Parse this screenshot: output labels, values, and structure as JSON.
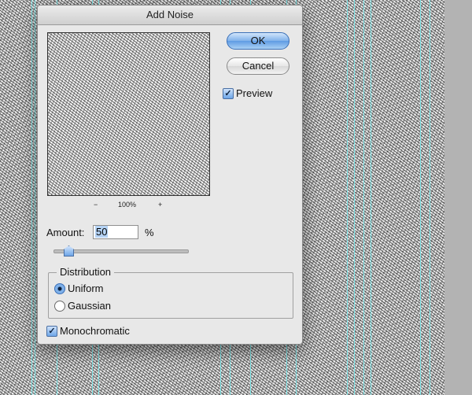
{
  "dialog": {
    "title": "Add Noise",
    "ok_label": "OK",
    "cancel_label": "Cancel",
    "preview_label": "Preview",
    "preview_checked": true,
    "zoom_out_symbol": "−",
    "zoom_level": "100%",
    "zoom_in_symbol": "+",
    "amount_label": "Amount:",
    "amount_value": "50",
    "amount_unit": "%",
    "amount_slider_value_percent": 50,
    "distribution": {
      "legend": "Distribution",
      "options": [
        "Uniform",
        "Gaussian"
      ],
      "selected": "Uniform"
    },
    "monochromatic_label": "Monochromatic",
    "monochromatic_checked": true
  },
  "colors": {
    "guide": "#7fe3e6",
    "accent": "#6ea6e8",
    "dialog_bg": "#e8e8e8"
  },
  "icons": {
    "checkmark": "check-icon"
  }
}
